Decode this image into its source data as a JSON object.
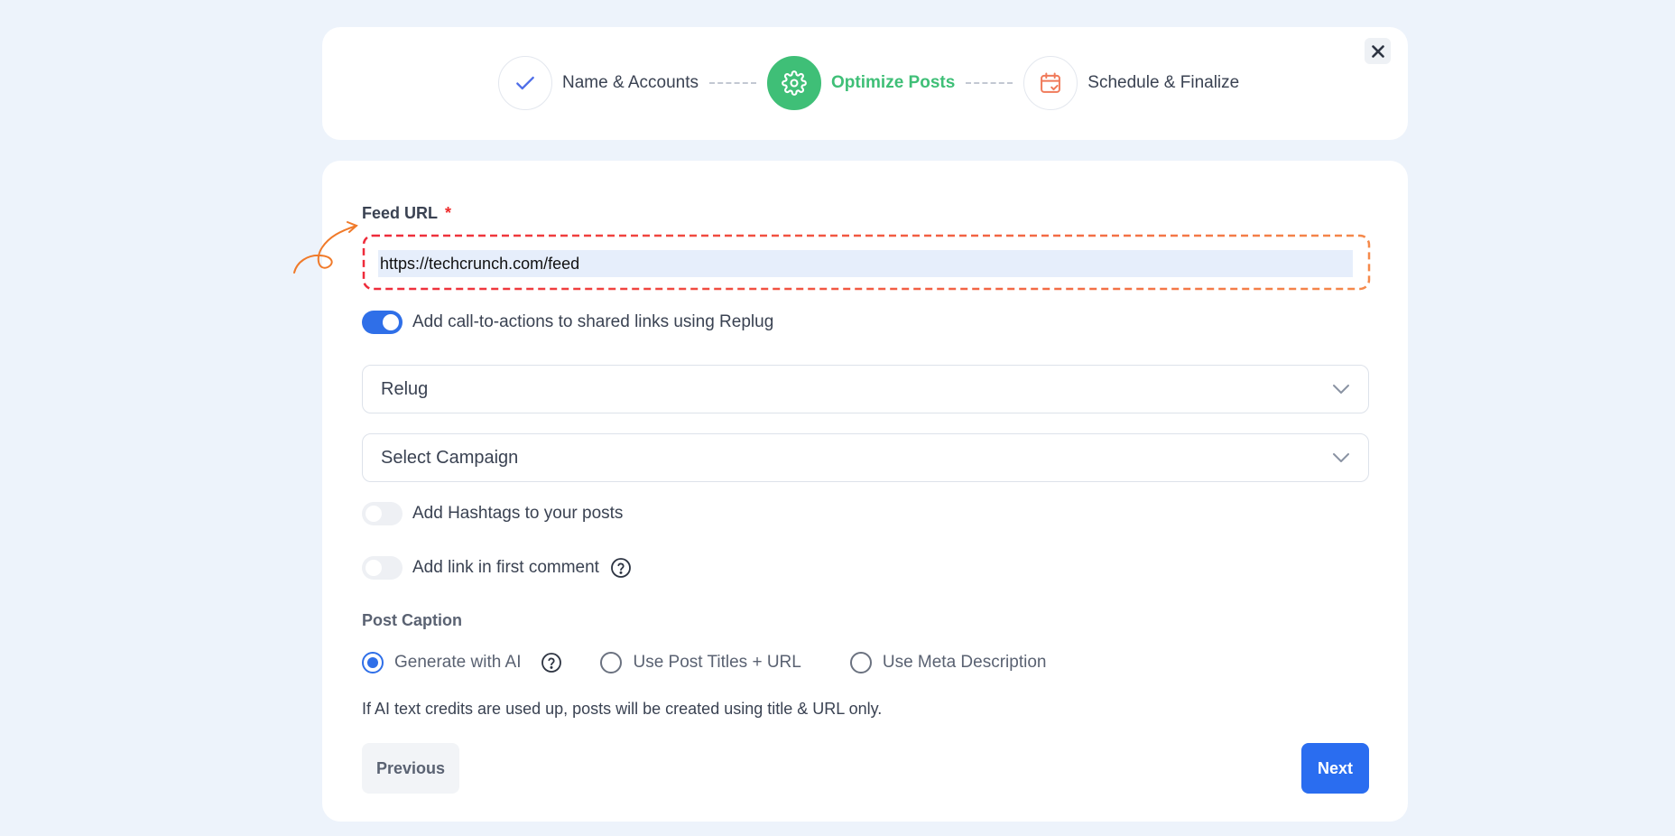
{
  "stepper": {
    "steps": [
      {
        "label": "Name & Accounts",
        "icon": "check-icon",
        "state": "done"
      },
      {
        "label": "Optimize Posts",
        "icon": "gear-icon",
        "state": "active"
      },
      {
        "label": "Schedule & Finalize",
        "icon": "calendar-icon",
        "state": "pending"
      }
    ]
  },
  "close": {
    "icon": "close-icon"
  },
  "feed": {
    "label": "Feed URL",
    "required_mark": "*",
    "value": "https://techcrunch.com/feed"
  },
  "cta_toggle": {
    "label": "Add call-to-actions to shared links using Replug",
    "on": true
  },
  "brand_select": {
    "value": "Relug",
    "icon": "chevron-down-icon"
  },
  "campaign_select": {
    "value": "Select Campaign",
    "icon": "chevron-down-icon"
  },
  "hashtag_toggle": {
    "label": "Add Hashtags to your posts",
    "on": false
  },
  "first_comment_toggle": {
    "label": "Add link in first comment",
    "on": false,
    "icon": "help-icon"
  },
  "caption": {
    "label": "Post Caption",
    "options": [
      {
        "label": "Generate with AI",
        "checked": true
      },
      {
        "label": "Use Post Titles + URL",
        "checked": false
      },
      {
        "label": "Use Meta Description",
        "checked": false
      }
    ],
    "note": "If AI text credits are used up, posts will be created using title & URL only."
  },
  "actions": {
    "previous": "Previous",
    "next": "Next"
  },
  "colors": {
    "accent": "#2a6df0",
    "active_step": "#3fbf77",
    "required": "#ee2b2b",
    "annotation": "#f07a2a"
  }
}
